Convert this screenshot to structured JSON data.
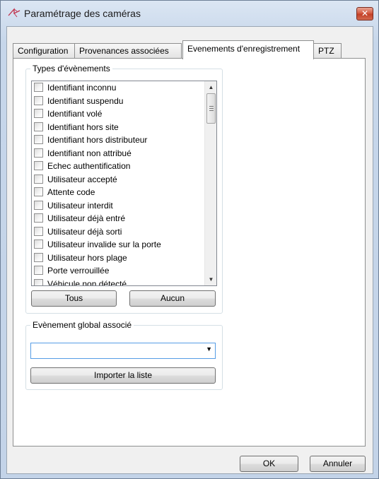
{
  "window": {
    "title": "Paramétrage des caméras",
    "close_label": "✕",
    "accent_close": "#c13d24"
  },
  "tabs": [
    {
      "label": "Configuration",
      "active": false
    },
    {
      "label": "Provenances associées",
      "active": false
    },
    {
      "label": "Evenements d'enregistrement",
      "active": true
    },
    {
      "label": "PTZ",
      "active": false
    }
  ],
  "event_types_group": {
    "legend": "Types d'évènements",
    "items": [
      {
        "label": "Identifiant inconnu",
        "checked": false
      },
      {
        "label": "Identifiant suspendu",
        "checked": false
      },
      {
        "label": "Identifiant volé",
        "checked": false
      },
      {
        "label": "Identifiant hors site",
        "checked": false
      },
      {
        "label": "Identifiant hors distributeur",
        "checked": false
      },
      {
        "label": "Identifiant non attribué",
        "checked": false
      },
      {
        "label": "Echec authentification",
        "checked": false
      },
      {
        "label": "Utilisateur accepté",
        "checked": false
      },
      {
        "label": "Attente code",
        "checked": false
      },
      {
        "label": "Utilisateur interdit",
        "checked": false
      },
      {
        "label": "Utilisateur déjà entré",
        "checked": false
      },
      {
        "label": "Utilisateur déjà sorti",
        "checked": false
      },
      {
        "label": "Utilisateur invalide sur la porte",
        "checked": false
      },
      {
        "label": "Utilisateur hors plage",
        "checked": false
      },
      {
        "label": "Porte verrouillée",
        "checked": false
      },
      {
        "label": "Véhicule non détecté",
        "checked": false
      }
    ],
    "all_button": "Tous",
    "none_button": "Aucun"
  },
  "global_event_group": {
    "legend": "Evènement global associé",
    "combo_value": "",
    "import_button": "Importer la liste"
  },
  "footer": {
    "ok_button": "OK",
    "cancel_button": "Annuler"
  }
}
